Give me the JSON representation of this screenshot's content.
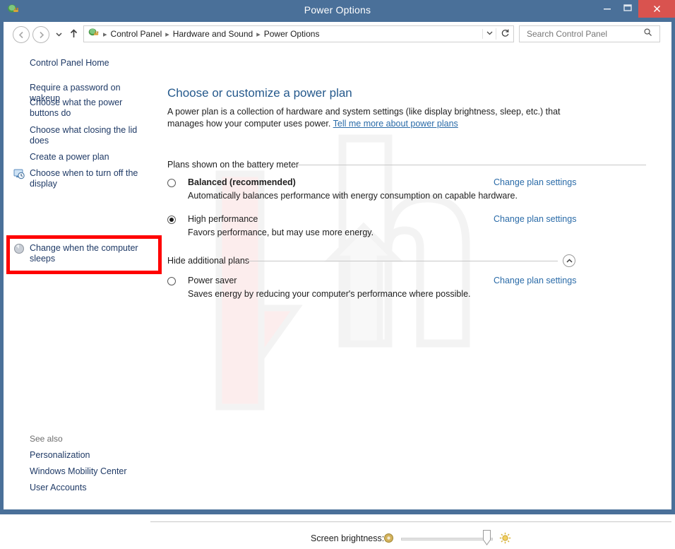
{
  "window": {
    "title": "Power Options",
    "icon": "power-plug-icon",
    "controls": {
      "minimize": "minimize-icon",
      "maximize": "maximize-icon",
      "close": "close-icon"
    },
    "colors": {
      "titlebar": "#4a7099",
      "close_button": "#d9534f",
      "accent_link": "#2a6ba8",
      "heading": "#25598c",
      "highlight_box": "#ff0000"
    }
  },
  "navbar": {
    "back": "back-arrow",
    "forward": "forward-arrow",
    "recent": "dropdown-chevron",
    "up": "up-arrow",
    "breadcrumbs": [
      "Control Panel",
      "Hardware and Sound",
      "Power Options"
    ],
    "separator": "▸",
    "address_chevron": "∨",
    "refresh": "refresh-icon"
  },
  "search": {
    "placeholder": "Search Control Panel",
    "value": "",
    "icon": "search-icon"
  },
  "help": {
    "label": "?",
    "name": "help-icon"
  },
  "sidebar": {
    "home": "Control Panel Home",
    "items": [
      {
        "label": "Require a password on wakeup",
        "icon": null
      },
      {
        "label": "Choose what the power buttons do",
        "icon": null
      },
      {
        "label": "Choose what closing the lid does",
        "icon": null
      },
      {
        "label": "Create a power plan",
        "icon": null
      },
      {
        "label": "Choose when to turn off the display",
        "icon": "display-clock-icon"
      },
      {
        "label": "Change when the computer sleeps",
        "icon": "sleep-moon-icon",
        "highlighted": true
      }
    ],
    "see_also_label": "See also",
    "see_also": [
      "Personalization",
      "Windows Mobility Center",
      "User Accounts"
    ]
  },
  "main": {
    "title": "Choose or customize a power plan",
    "description_part1": "A power plan is a collection of hardware and system settings (like display brightness, sleep, etc.) that manages how your computer uses power. ",
    "description_link": "Tell me more about power plans",
    "section_battery": "Plans shown on the battery meter",
    "section_additional": "Hide additional plans",
    "collapse_icon": "chevron-up-icon",
    "change_link": "Change plan settings",
    "plans": [
      {
        "name": "Balanced (recommended)",
        "description": "Automatically balances performance with energy consumption on capable hardware.",
        "selected": false,
        "bold": true,
        "link": "Change plan settings"
      },
      {
        "name": "High performance",
        "description": "Favors performance, but may use more energy.",
        "selected": true,
        "bold": false,
        "link": "Change plan settings"
      },
      {
        "name": "Power saver",
        "description": "Saves energy by reducing your computer's performance where possible.",
        "selected": false,
        "bold": false,
        "link": "Change plan settings"
      }
    ]
  },
  "brightness": {
    "label": "Screen brightness:",
    "low_icon": "sun-dim-icon",
    "high_icon": "sun-bright-icon",
    "value": 90
  }
}
